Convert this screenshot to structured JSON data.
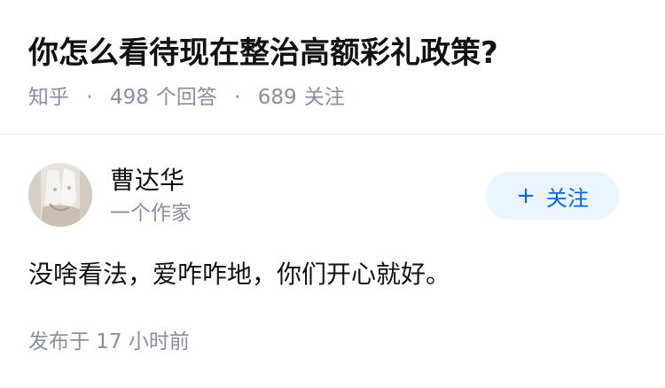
{
  "question": {
    "title": "你怎么看待现在整治高额彩礼政策?",
    "source": "知乎",
    "answer_count": "498",
    "answer_label": "个回答",
    "follower_count": "689",
    "follower_label": "关注",
    "separator": "·"
  },
  "answer": {
    "author_name": "曹达华",
    "author_bio": "一个作家",
    "avatar_icon": "avatar-image",
    "follow_button": {
      "icon": "+",
      "label": "关注"
    },
    "content": "没啥看法，爱咋咋地，你们开心就好。",
    "published_time": "发布于 17 小时前"
  },
  "colors": {
    "title": "#121212",
    "meta": "#8590a6",
    "follow_bg": "#ebf5ff",
    "follow_text": "#0066ff",
    "divider": "#ebebeb"
  }
}
